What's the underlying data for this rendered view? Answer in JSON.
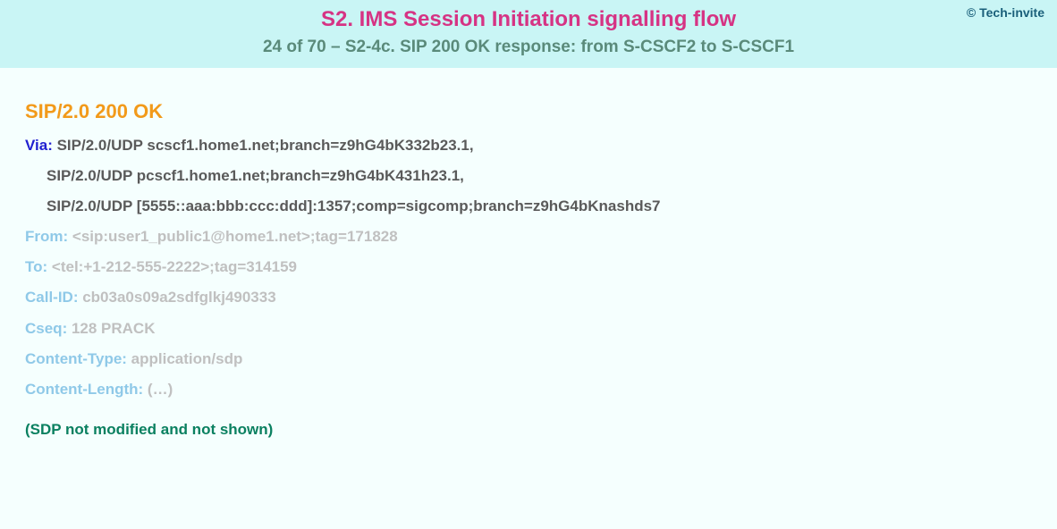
{
  "copyright": "© Tech-invite",
  "title": "S2. IMS Session Initiation signalling flow",
  "subtitle": "24 of 70 – S2-4c. SIP 200 OK response: from S-CSCF2 to S-CSCF1",
  "sip_status": "SIP/2.0 200 OK",
  "headers": {
    "via": {
      "label": "Via:",
      "line1": " SIP/2.0/UDP scscf1.home1.net;branch=z9hG4bK332b23.1,",
      "line2": "SIP/2.0/UDP pcscf1.home1.net;branch=z9hG4bK431h23.1,",
      "line3": "SIP/2.0/UDP [5555::aaa:bbb:ccc:ddd]:1357;comp=sigcomp;branch=z9hG4bKnashds7"
    },
    "from": {
      "label": "From:",
      "value": " <sip:user1_public1@home1.net>;tag=171828"
    },
    "to": {
      "label": "To:",
      "value": " <tel:+1-212-555-2222>;tag=314159"
    },
    "call_id": {
      "label": "Call-ID:",
      "value": " cb03a0s09a2sdfglkj490333"
    },
    "cseq": {
      "label": "Cseq:",
      "value": " 128 PRACK"
    },
    "content_type": {
      "label": "Content-Type:",
      "value": " application/sdp"
    },
    "content_length": {
      "label": "Content-Length:",
      "value": " (…)"
    }
  },
  "note": "(SDP not modified and not shown)"
}
